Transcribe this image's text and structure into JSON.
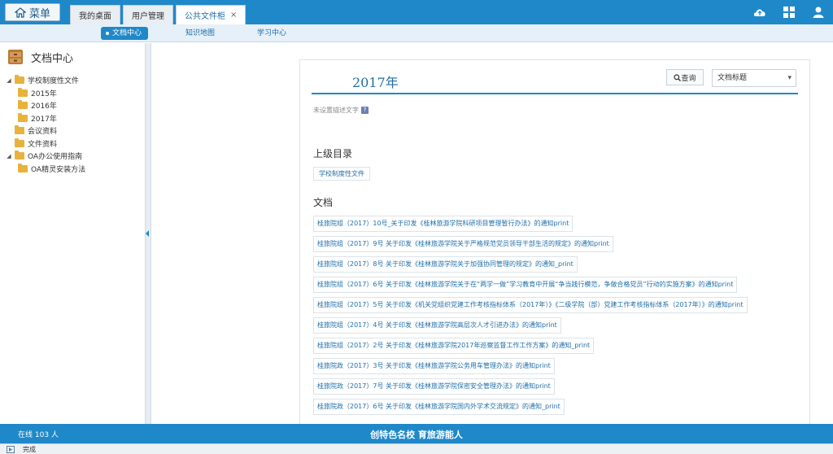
{
  "topbar": {
    "menu_label": "菜单",
    "tabs": [
      {
        "label": "我的桌面",
        "active": false
      },
      {
        "label": "用户管理",
        "active": false
      },
      {
        "label": "公共文件柜",
        "active": true,
        "closable": "×"
      }
    ],
    "icons": [
      "cloud-icon",
      "apps-icon",
      "user-icon"
    ]
  },
  "subnav": {
    "items": [
      {
        "label": "文档中心",
        "active": true
      },
      {
        "label": "知识地图",
        "active": false
      },
      {
        "label": "学习中心",
        "active": false
      }
    ]
  },
  "sidebar": {
    "title": "文档中心",
    "tree": [
      {
        "label": "学校制度性文件",
        "level": 0,
        "toggle": "◢"
      },
      {
        "label": "2015年",
        "level": 1
      },
      {
        "label": "2016年",
        "level": 1
      },
      {
        "label": "2017年",
        "level": 1
      },
      {
        "label": "会议资料",
        "level": 0
      },
      {
        "label": "文件资料",
        "level": 0
      },
      {
        "label": "OA办公使用指南",
        "level": 0,
        "toggle": "◢"
      },
      {
        "label": "OA精灵安装方法",
        "level": 1
      }
    ]
  },
  "panel": {
    "title": "2017年",
    "search_label": "查询",
    "select_value": "文档标题",
    "note": "未设置描述文字",
    "parent_section": "上级目录",
    "parent_link": "学校制度性文件",
    "docs_section": "文档",
    "docs": [
      "桂旅院组（2017）10号_关于印发《桂林旅游学院科研项目管理暂行办法》的通知print",
      "桂旅院组（2017）9号 关于印发《桂林旅游学院关于严格规范党员领导干部生活的规定》的通知print",
      "桂旅院组（2017）8号 关于印发《桂林旅游学院关于加强协同管理的规定》的通知_print",
      "桂旅院组（2017）6号 关于印发《桂林旅游学院关于在“两学一做”学习教育中开展“争当践行模范，争做合格党员”行动的实施方案》的通知print",
      "桂旅院组（2017）5号 关于印发《机关党组织党建工作考核指标体系（2017年）》《二级学院（部）党建工作考核指标体系（2017年）》的通知print",
      "桂旅院组（2017）4号 关于印发《桂林旅游学院高层次人才引进办法》的通知print",
      "桂旅院组（2017）2号 关于印发《桂林旅游学院2017年巡察监督工作工作方案》的通知_print",
      "桂旅院政（2017）3号 关于印发《桂林旅游学院公务用车管理办法》的通知print",
      "桂旅院政（2017）7号 关于印发《桂林旅游学院保密安全管理办法》的通知print",
      "桂旅院政（2017）6号 关于印发《桂林旅游学院国内外学术交流规定》的通知_print"
    ]
  },
  "footer": {
    "online": "在线 103 人",
    "slogan": "创特色名校 育旅游能人"
  },
  "statusbar": {
    "text": "完成"
  },
  "colors": {
    "accent": "#1f88c9",
    "link": "#1f6ea8",
    "folder": "#e8b23d"
  }
}
